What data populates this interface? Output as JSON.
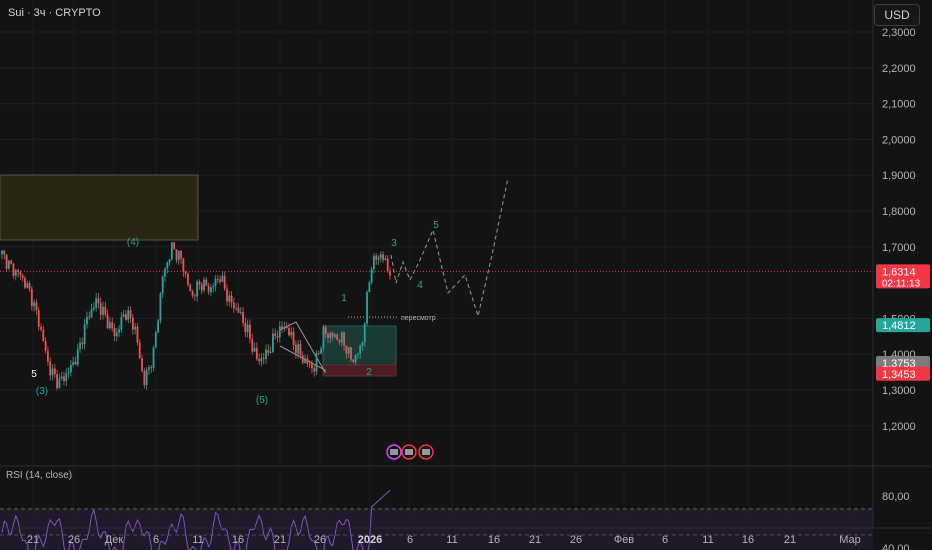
{
  "header": {
    "title": "Sui · 3ч · CRYPTO",
    "currency": "USD"
  },
  "price_axis": {
    "ticks": [
      "2,3000",
      "2,2000",
      "2,1000",
      "2,0000",
      "1,9000",
      "1,8000",
      "1,7000",
      "1,5000",
      "1,4000",
      "1,3000",
      "1,2000"
    ],
    "tick_values": [
      2.3,
      2.2,
      2.1,
      2.0,
      1.9,
      1.8,
      1.7,
      1.5,
      1.4,
      1.3,
      1.2
    ],
    "labels": [
      {
        "text": "1,6314",
        "sub": "02:11:13",
        "value": 1.6314,
        "color": "#f23645"
      },
      {
        "text": "1,4812",
        "value": 1.4812,
        "color": "#26a69a"
      },
      {
        "text": "1,3753",
        "value": 1.3753,
        "color": "#7c7c7c"
      },
      {
        "text": "1,3453",
        "value": 1.3453,
        "color": "#f23645"
      }
    ]
  },
  "time_axis": [
    "21",
    "26",
    "Дек",
    "6",
    "11",
    "16",
    "21",
    "26",
    "2026",
    "6",
    "11",
    "16",
    "21",
    "26",
    "Фев",
    "6",
    "11",
    "16",
    "21",
    "Мар"
  ],
  "annotations": {
    "wave_5_left": "5",
    "wave_3_paren": "(3)",
    "wave_4_paren": "(4)",
    "wave_5_paren": "(5)",
    "wave_1": "1",
    "wave_2": "2",
    "wave_3": "3",
    "wave_4": "4",
    "wave_5": "5",
    "review_label": "пересмотр"
  },
  "rsi": {
    "label": "RSI (14, close)",
    "ticks": [
      "80,00",
      "40,00"
    ],
    "tick_values": [
      80,
      40
    ]
  },
  "chart_data": {
    "type": "candlestick",
    "ylim": [
      1.11,
      2.34
    ],
    "current_price": 1.6314,
    "candles_approx_close": [
      1.68,
      1.64,
      1.62,
      1.57,
      1.48,
      1.36,
      1.32,
      1.35,
      1.4,
      1.5,
      1.55,
      1.5,
      1.45,
      1.52,
      1.48,
      1.32,
      1.4,
      1.62,
      1.7,
      1.66,
      1.56,
      1.6,
      1.58,
      1.62,
      1.55,
      1.52,
      1.46,
      1.38,
      1.4,
      1.46,
      1.48,
      1.42,
      1.38,
      1.36,
      1.46,
      1.45,
      1.44,
      1.38,
      1.42,
      1.65,
      1.68,
      1.63
    ]
  },
  "colors": {
    "up": "#26a69a",
    "down": "#ef5350",
    "background": "#131313",
    "rsi": "#7e57c2"
  }
}
